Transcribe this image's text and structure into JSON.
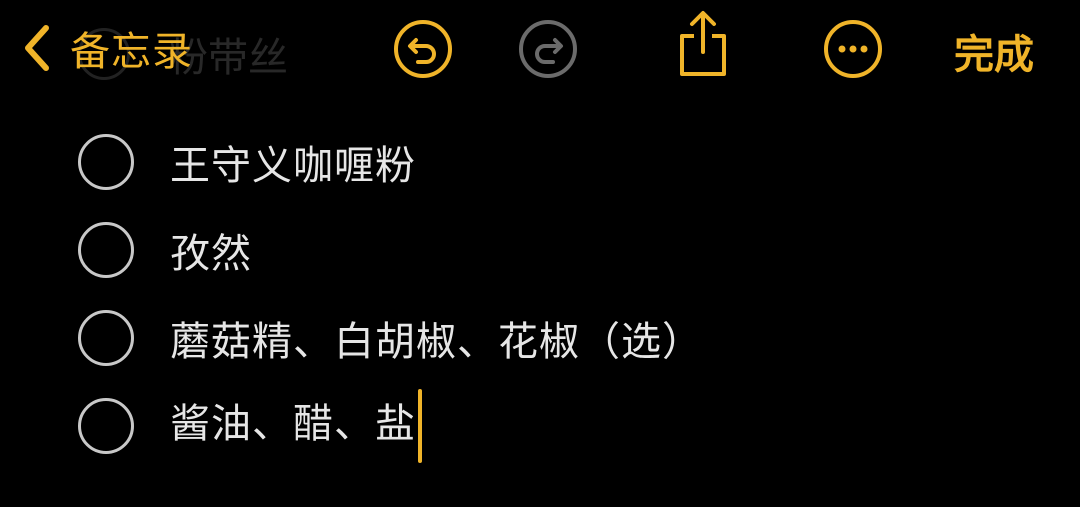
{
  "toolbar": {
    "back_label": "备忘录",
    "done_label": "完成",
    "icons": {
      "back": "chevron-left-icon",
      "undo": "undo-icon",
      "redo": "redo-icon",
      "share": "share-icon",
      "more": "more-icon"
    }
  },
  "hidden_item": {
    "text": "粉带丝"
  },
  "checklist": {
    "items": [
      {
        "text": "王守义咖喱粉",
        "checked": false
      },
      {
        "text": "孜然",
        "checked": false
      },
      {
        "text": "蘑菇精、白胡椒、花椒（选）",
        "checked": false
      },
      {
        "text": "酱油、醋、盐",
        "checked": false
      }
    ]
  },
  "colors": {
    "accent": "#F0B429",
    "disabled": "#6b6b6b",
    "background": "#000000",
    "text": "#e6e6e6"
  }
}
